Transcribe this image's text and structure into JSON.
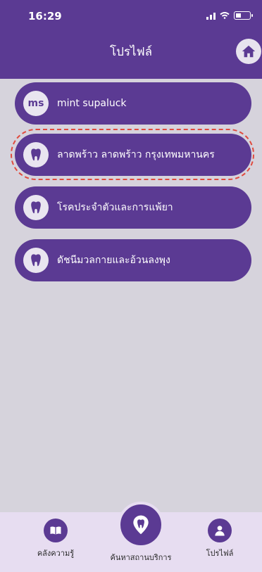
{
  "status_bar": {
    "time": "16:29"
  },
  "header": {
    "title": "โปรไฟล์",
    "home_icon": "home-icon"
  },
  "colors": {
    "primary": "#5b3a93",
    "background": "#d6d3dc",
    "highlight_dashed": "#e04b3f",
    "bottom_bar": "#e7ddf1"
  },
  "profile": {
    "initials": "ms",
    "name": "mint supaluck"
  },
  "menu": [
    {
      "label": "ลาดพร้าว ลาดพร้าว กรุงเทพมหานคร",
      "icon": "tooth-icon",
      "selected": true
    },
    {
      "label": "โรคประจำตัวและการแพ้ยา",
      "icon": "tooth-icon"
    },
    {
      "label": "ดัชนีมวลกายและอ้วนลงพุง",
      "icon": "tooth-icon"
    }
  ],
  "bottom_nav": [
    {
      "label": "คลังความรู้",
      "icon": "book-icon"
    },
    {
      "label": "ค้นหาสถานบริการ",
      "icon": "location-tooth-icon"
    },
    {
      "label": "โปรไฟล์",
      "icon": "user-icon"
    }
  ]
}
